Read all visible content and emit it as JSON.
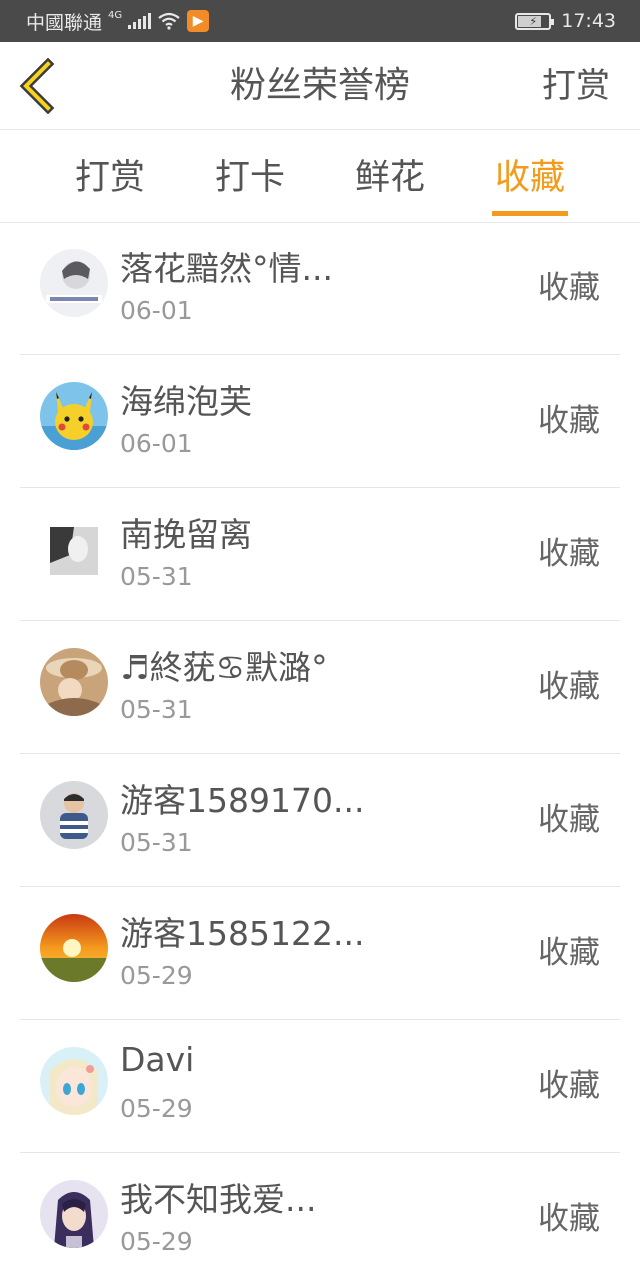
{
  "status_bar": {
    "carrier": "中國聯通",
    "network": "4G",
    "time": "17:43"
  },
  "header": {
    "title": "粉丝荣誉榜",
    "action_label": "打赏",
    "back_icon": "chevron-left-icon"
  },
  "tabs": [
    {
      "label": "打赏",
      "active": false
    },
    {
      "label": "打卡",
      "active": false
    },
    {
      "label": "鲜花",
      "active": false
    },
    {
      "label": "收藏",
      "active": true
    }
  ],
  "colors": {
    "accent": "#f29b1d",
    "status_bar": "#4a4a4a",
    "text": "#555555",
    "secondary_text": "#999999"
  },
  "rows": [
    {
      "name": "落花黯然°情...",
      "date": "06-01",
      "action": "收藏"
    },
    {
      "name": "海绵泡芙",
      "date": "06-01",
      "action": "收藏"
    },
    {
      "name": "南挽留离",
      "date": "05-31",
      "action": "收藏"
    },
    {
      "name": "♬終莸♋默潞°",
      "date": "05-31",
      "action": "收藏"
    },
    {
      "name": "游客1589170...",
      "date": "05-31",
      "action": "收藏"
    },
    {
      "name": "游客1585122...",
      "date": "05-29",
      "action": "收藏"
    },
    {
      "name": "Davi",
      "date": "05-29",
      "action": "收藏"
    },
    {
      "name": "我不知我爱...",
      "date": "05-29",
      "action": "收藏"
    }
  ]
}
